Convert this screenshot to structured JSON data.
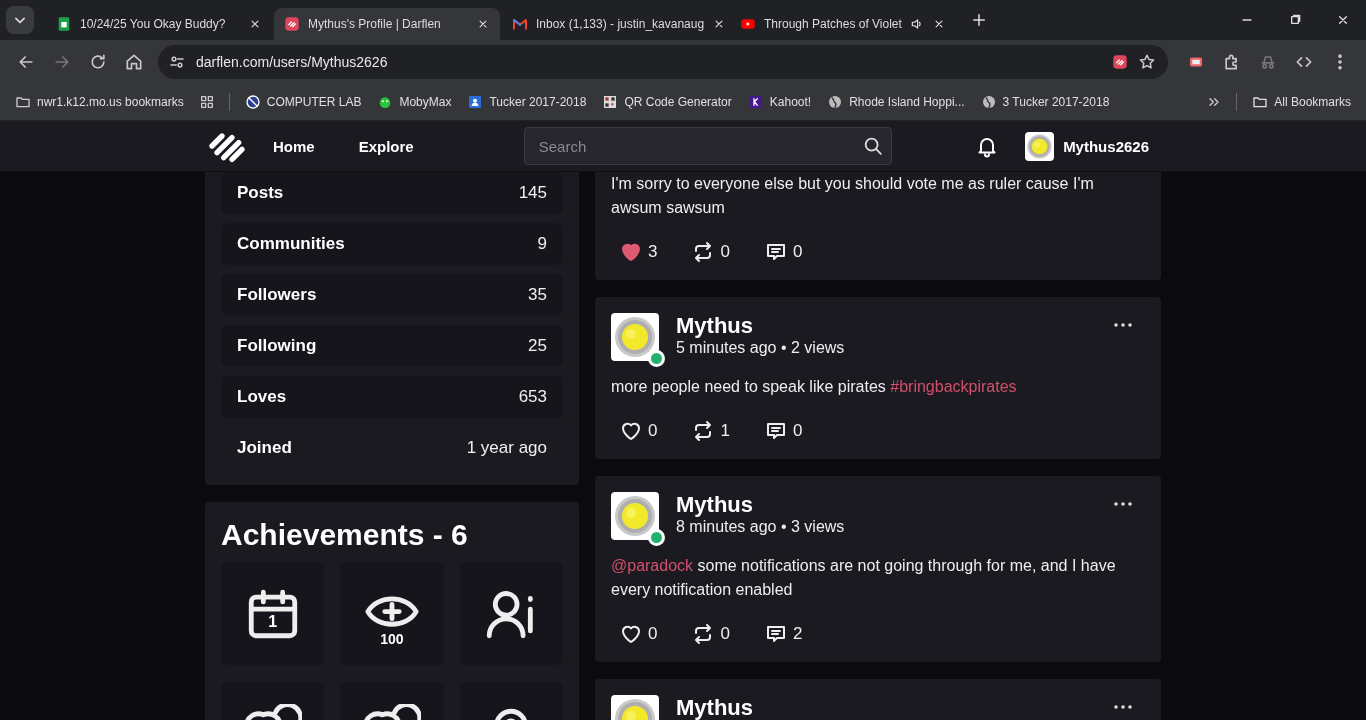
{
  "browser": {
    "tabs": [
      {
        "title": "10/24/25 You Okay Buddy?",
        "selected": false,
        "audio": false
      },
      {
        "title": "Mythus's Profile | Darflen",
        "selected": true,
        "audio": false
      },
      {
        "title": "Inbox (1,133) - justin_kavanaug",
        "selected": false,
        "audio": false
      },
      {
        "title": "Through Patches of Violet",
        "selected": false,
        "audio": true
      }
    ],
    "address": "darflen.com/users/Mythus2626",
    "bookmarks": [
      {
        "label": "nwr1.k12.mo.us bookmarks"
      },
      {
        "label": "COMPUTER LAB"
      },
      {
        "label": "MobyMax"
      },
      {
        "label": "Tucker 2017-2018"
      },
      {
        "label": "QR Code Generator"
      },
      {
        "label": "Kahoot!"
      },
      {
        "label": "Rhode Island Hoppi..."
      },
      {
        "label": "3 Tucker 2017-2018"
      }
    ],
    "all_bookmarks": "All Bookmarks"
  },
  "site": {
    "nav": [
      "Home",
      "Explore"
    ],
    "search": {
      "placeholder": "Search"
    },
    "user": "Mythus2626"
  },
  "stats": [
    {
      "label": "Posts",
      "value": "145",
      "kind": "boxed"
    },
    {
      "label": "Communities",
      "value": "9",
      "kind": "boxed"
    },
    {
      "label": "Followers",
      "value": "35",
      "kind": "boxed"
    },
    {
      "label": "Following",
      "value": "25",
      "kind": "boxed"
    },
    {
      "label": "Loves",
      "value": "653",
      "kind": "boxed"
    },
    {
      "label": "Joined",
      "value": "1 year ago",
      "kind": "plain"
    }
  ],
  "achievements": {
    "title": "Achievements - 6",
    "badges": [
      {
        "kind": "calendar",
        "label": "1"
      },
      {
        "kind": "eye",
        "label": "100"
      },
      {
        "kind": "person-mark"
      },
      {
        "kind": "hearts"
      },
      {
        "kind": "hearts"
      },
      {
        "kind": "pin"
      }
    ]
  },
  "posts": [
    {
      "text": [
        {
          "kind": "plain",
          "text": "I'm sorry to everyone else but you should vote me as ruler cause I'm awsum sawsum"
        }
      ],
      "liked": true,
      "likes": "3",
      "reposts": "0",
      "comments": "0"
    },
    {
      "author": "Mythus",
      "online": true,
      "meta": "5 minutes ago • 2 views",
      "text": [
        {
          "kind": "plain",
          "text": "more people need to speak like pirates "
        },
        {
          "kind": "hashtag",
          "text": "#bringbackpirates"
        }
      ],
      "liked": false,
      "likes": "0",
      "reposts": "1",
      "comments": "0"
    },
    {
      "author": "Mythus",
      "online": true,
      "meta": "8 minutes ago • 3 views",
      "text": [
        {
          "kind": "mention",
          "text": "@paradock"
        },
        {
          "kind": "plain",
          "text": " some notifications are not going through for me, and I have every notification enabled"
        }
      ],
      "liked": false,
      "likes": "0",
      "reposts": "0",
      "comments": "2"
    },
    {
      "author": "Mythus"
    }
  ]
}
